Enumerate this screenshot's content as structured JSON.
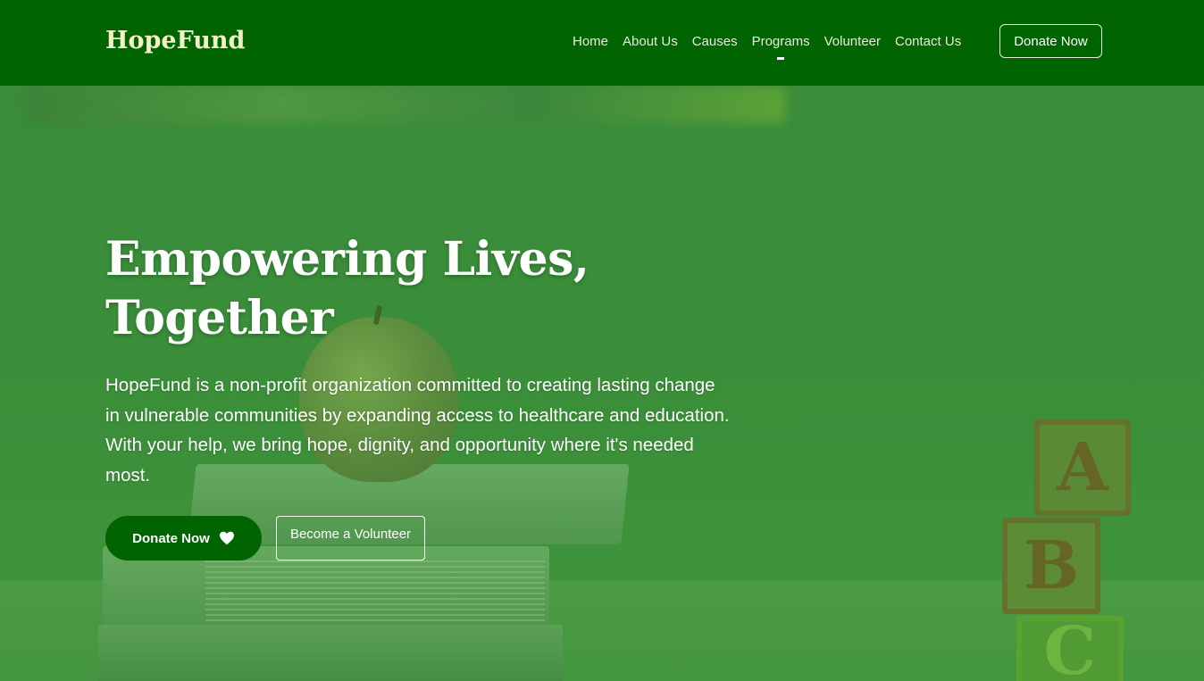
{
  "navbar": {
    "brand": "HopeFund",
    "links": [
      {
        "label": "Home"
      },
      {
        "label": "About Us"
      },
      {
        "label": "Causes"
      },
      {
        "label": "Programs",
        "active": true
      },
      {
        "label": "Volunteer"
      },
      {
        "label": "Contact Us"
      }
    ],
    "donate_label": "Donate Now"
  },
  "hero": {
    "title_line1": "Empowering Lives,",
    "title_line2": "Together",
    "description": "HopeFund is a non-profit organization committed to creating lasting change in vulnerable communities by expanding access to healthcare and education. With your help, we bring hope, dignity, and opportunity where it's needed most.",
    "primary_button": "Donate Now",
    "primary_button_icon": "heart-icon",
    "secondary_button": "Become a Volunteer",
    "blocks": [
      "A",
      "B",
      "C"
    ]
  },
  "colors": {
    "nav_bg": "#006400",
    "brand_text": "#f3f0c8",
    "overlay_green": "#3f8a3f",
    "button_primary": "#006400"
  }
}
